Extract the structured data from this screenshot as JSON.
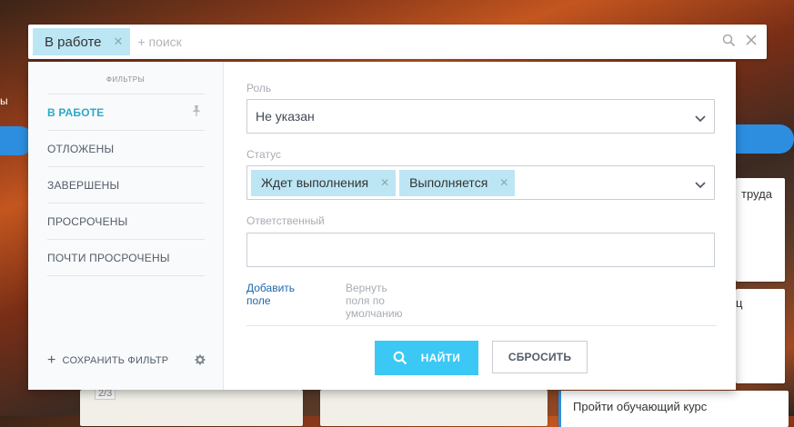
{
  "search": {
    "active_chip": "В работе",
    "placeholder": "+ поиск"
  },
  "sidebar": {
    "title": "ФИЛЬТРЫ",
    "items": [
      {
        "label": "В РАБОТЕ",
        "active": true
      },
      {
        "label": "ОТЛОЖЕНЫ",
        "active": false
      },
      {
        "label": "ЗАВЕРШЕНЫ",
        "active": false
      },
      {
        "label": "ПРОСРОЧЕНЫ",
        "active": false
      },
      {
        "label": "ПОЧТИ ПРОСРОЧЕНЫ",
        "active": false
      }
    ],
    "save_filter": "СОХРАНИТЬ ФИЛЬТР"
  },
  "form": {
    "role": {
      "label": "Роль",
      "value": "Не указан"
    },
    "status": {
      "label": "Статус",
      "tags": [
        "Ждет выполнения",
        "Выполняется"
      ]
    },
    "responsible": {
      "label": "Ответственный",
      "value": ""
    },
    "add_field": "Добавить поле",
    "reset_fields": "Вернуть поля по умолчанию"
  },
  "buttons": {
    "find": "НАЙТИ",
    "reset": "СБРОСИТЬ"
  },
  "background": {
    "card_partial_1": "труда",
    "card_partial_2": "ц",
    "card_task": "Пройти обучающий курс",
    "card_counter": "2/3",
    "left_partial": "ы",
    "accent_blue": "#2d8ee0"
  },
  "colors": {
    "chip_bg": "#bde6f5",
    "primary_button": "#3bc8f5",
    "active_filter": "#2fa8c8",
    "link": "#2067b0"
  },
  "icons": [
    "search-icon",
    "close-icon",
    "pin-icon",
    "chevron-down-icon",
    "plus-icon",
    "gear-icon"
  ]
}
